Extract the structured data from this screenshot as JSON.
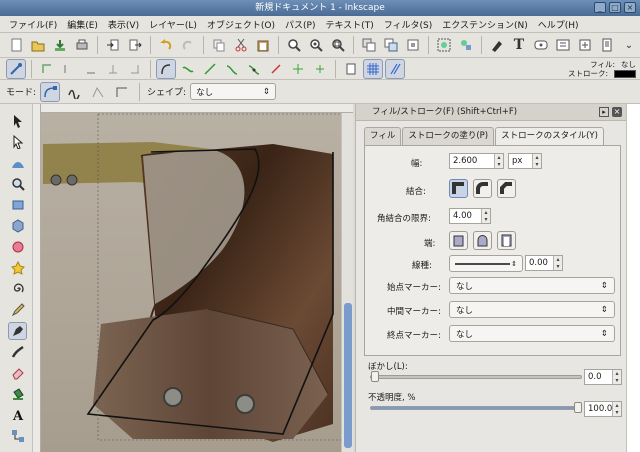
{
  "window": {
    "title": "新規ドキュメント 1 - Inkscape",
    "buttons": [
      "_",
      "□",
      "×"
    ]
  },
  "menu": [
    "ファイル(F)",
    "編集(E)",
    "表示(V)",
    "レイヤー(L)",
    "オブジェクト(O)",
    "パス(P)",
    "テキスト(T)",
    "フィルタ(S)",
    "エクステンション(N)",
    "ヘルプ(H)"
  ],
  "fill_indicator": {
    "fill_label": "フィル:",
    "fill_value": "なし",
    "stroke_label": "ストローク:",
    "stroke_color": "#000000"
  },
  "tool_controls": {
    "mode_label": "モード:",
    "shape_label": "シェイプ:",
    "shape_value": "なし"
  },
  "dialog": {
    "title": "フィル/ストローク(F) (Shift+Ctrl+F)",
    "tabs": [
      "フィル",
      "ストロークの塗り(P)",
      "ストロークのスタイル(Y)"
    ],
    "active_tab": 2,
    "width_label": "幅:",
    "width_value": "2.600",
    "unit_value": "px",
    "join_label": "結合:",
    "miter_label": "角結合の限界:",
    "miter_value": "4.00",
    "cap_label": "端:",
    "dash_label": "線種:",
    "dash_offset": "0.00",
    "start_marker_label": "始点マーカー:",
    "start_marker_value": "なし",
    "mid_marker_label": "中間マーカー:",
    "mid_marker_value": "なし",
    "end_marker_label": "終点マーカー:",
    "end_marker_value": "なし",
    "blur_label": "ぼかし(L):",
    "blur_value": "0.0",
    "opacity_label": "不透明度, %",
    "opacity_value": "100.0"
  },
  "icons": {
    "pencil_tool": "pencil-icon",
    "calligraphy_tool": "calligraphy-icon"
  }
}
